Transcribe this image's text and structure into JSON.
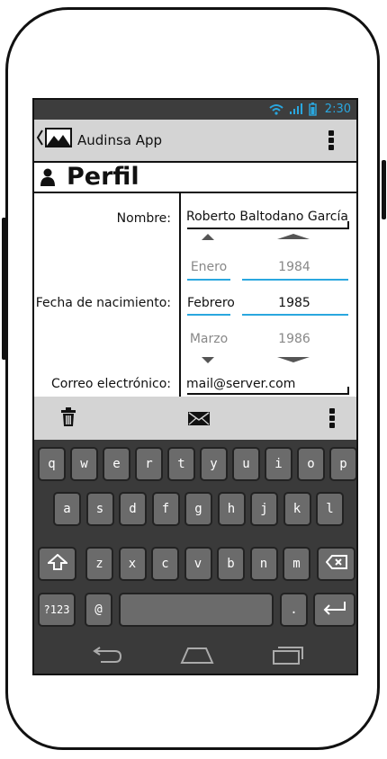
{
  "status_bar": {
    "time": "2:30",
    "icons": [
      "wifi-icon",
      "signal-icon",
      "battery-icon"
    ],
    "accent": "#2aa7df"
  },
  "action_bar": {
    "title": "Audinsa App",
    "icons": [
      "back-chevron-icon",
      "image-icon",
      "overflow-menu-icon"
    ]
  },
  "page": {
    "title": "Perfil",
    "icon": "person-icon"
  },
  "form": {
    "name_label": "Nombre:",
    "name_value": "Roberto Baltodano García",
    "birth_label": "Fecha de nacimiento:",
    "months": {
      "prev": "Enero",
      "selected": "Febrero",
      "next": "Marzo"
    },
    "years": {
      "prev": "1984",
      "selected": "1985",
      "next": "1986"
    },
    "email_label": "Correo electrónico:",
    "email_value": "mail@server.com"
  },
  "bottom_bar": {
    "icons": [
      "trash-icon",
      "mail-icon",
      "overflow-menu-icon"
    ]
  },
  "keyboard": {
    "row1": [
      "q",
      "w",
      "e",
      "r",
      "t",
      "y",
      "u",
      "i",
      "o",
      "p"
    ],
    "row2": [
      "a",
      "s",
      "d",
      "f",
      "g",
      "h",
      "j",
      "k",
      "l"
    ],
    "row3": [
      "z",
      "x",
      "c",
      "v",
      "b",
      "n",
      "m"
    ],
    "symbols_label": "?123",
    "at_label": "@",
    "period_label": ".",
    "icons": [
      "shift-icon",
      "backspace-icon",
      "enter-icon"
    ]
  },
  "nav_bar": {
    "icons": [
      "back-icon",
      "home-icon",
      "recents-icon"
    ]
  }
}
